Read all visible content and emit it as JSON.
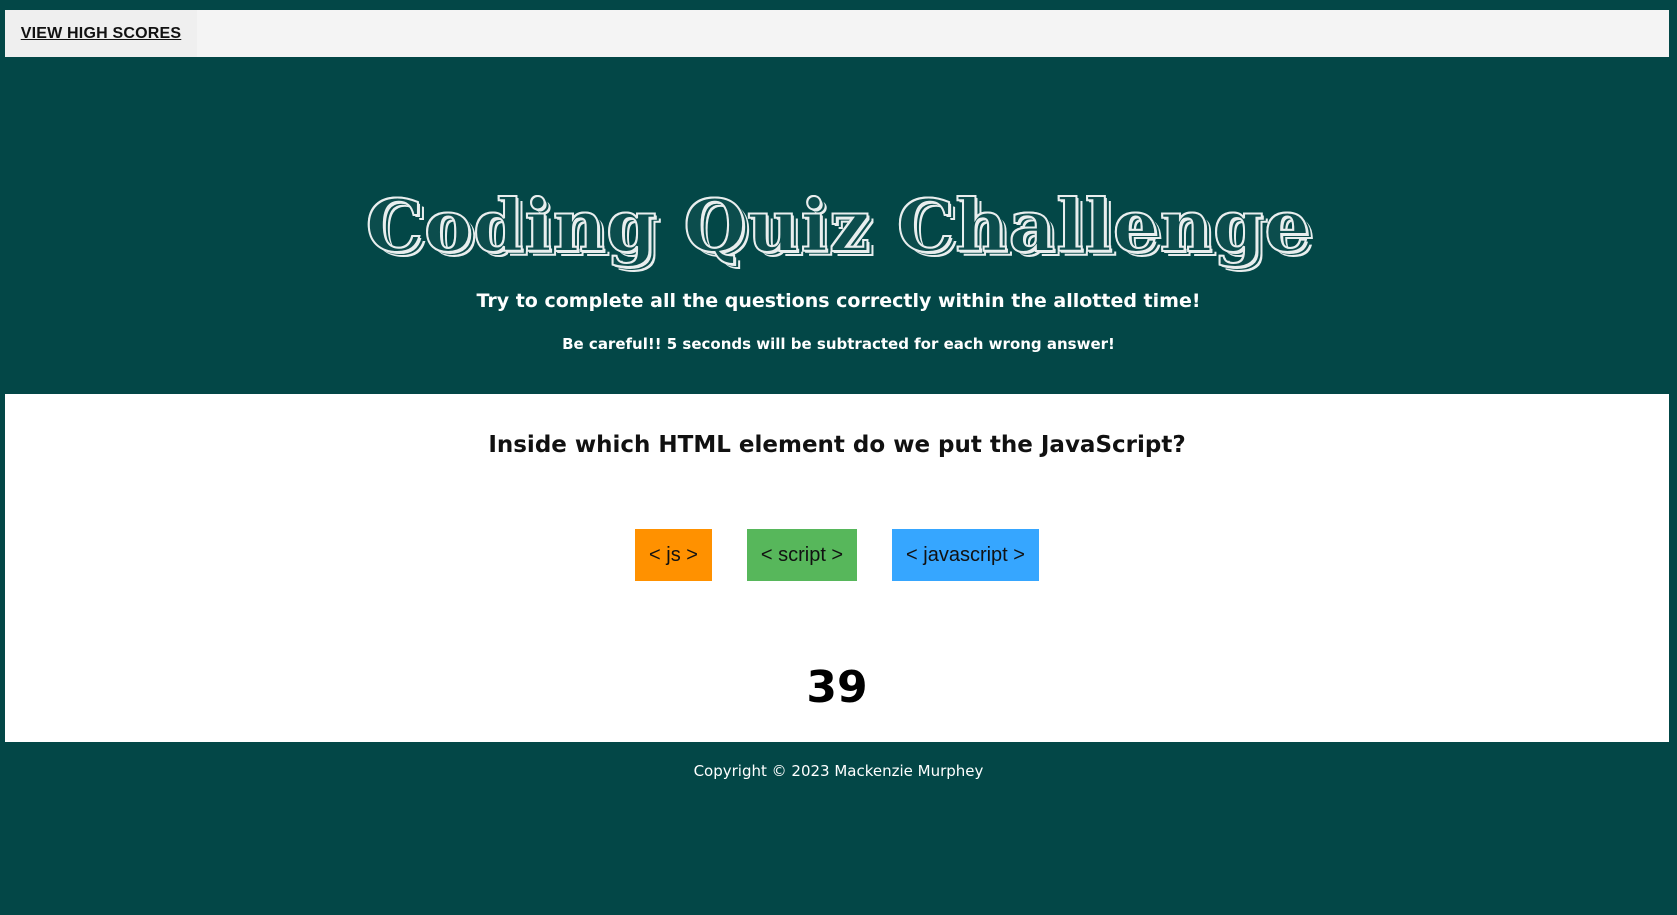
{
  "header": {
    "high_scores_link": "VIEW HIGH SCORES"
  },
  "hero": {
    "title": "Coding Quiz Challenge",
    "instructions": "Try to complete all the questions correctly within the allotted time!",
    "warning": "Be careful!! 5 seconds will be subtracted for each wrong answer!"
  },
  "quiz": {
    "question": "Inside which HTML element do we put the JavaScript?",
    "answers": [
      {
        "label": "< js >",
        "color": "#ff9100"
      },
      {
        "label": "< script >",
        "color": "#57b75b"
      },
      {
        "label": "< javascript >",
        "color": "#36a6ff"
      }
    ],
    "timer": "39"
  },
  "footer": {
    "copyright": "Copyright © 2023 Mackenzie Murphey"
  },
  "colors": {
    "page_background": "#034747",
    "panel_background": "#ffffff",
    "header_background": "#f4f4f4"
  }
}
